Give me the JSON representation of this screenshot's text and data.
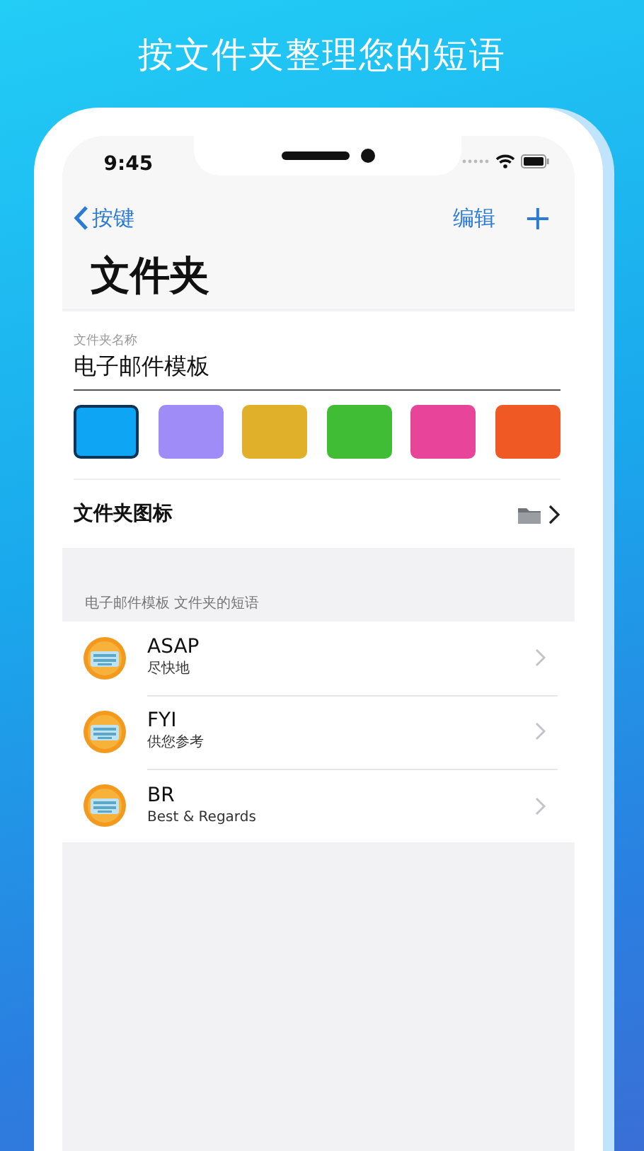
{
  "headline": "按文件夹整理您的短语",
  "status_bar": {
    "time": "9:45"
  },
  "nav": {
    "back": "按键",
    "actions": [
      {
        "label": "编辑",
        "kind": "text"
      },
      {
        "label": "+",
        "kind": "symbol"
      }
    ]
  },
  "title": "文件夹",
  "name_field": {
    "label": "文件夹名称",
    "value": "电子邮件模板"
  },
  "colors": [
    {
      "color": "#0ea5f5",
      "selected": true
    },
    {
      "color": "#a08cf7",
      "selected": false
    },
    {
      "color": "#e0b02a",
      "selected": false
    },
    {
      "color": "#41bd35",
      "selected": false
    },
    {
      "color": "#e8449a",
      "selected": false
    },
    {
      "color": "#ef5a24",
      "selected": false
    }
  ],
  "icon_row": {
    "label": "文件夹图标"
  },
  "section_header": "电子邮件模板 文件夹的短语",
  "phrases": [
    {
      "title": "ASAP",
      "subtitle": "尽快地"
    },
    {
      "title": "FYI",
      "subtitle": "供您参考"
    },
    {
      "title": "BR",
      "subtitle": "Best & Regards"
    }
  ]
}
